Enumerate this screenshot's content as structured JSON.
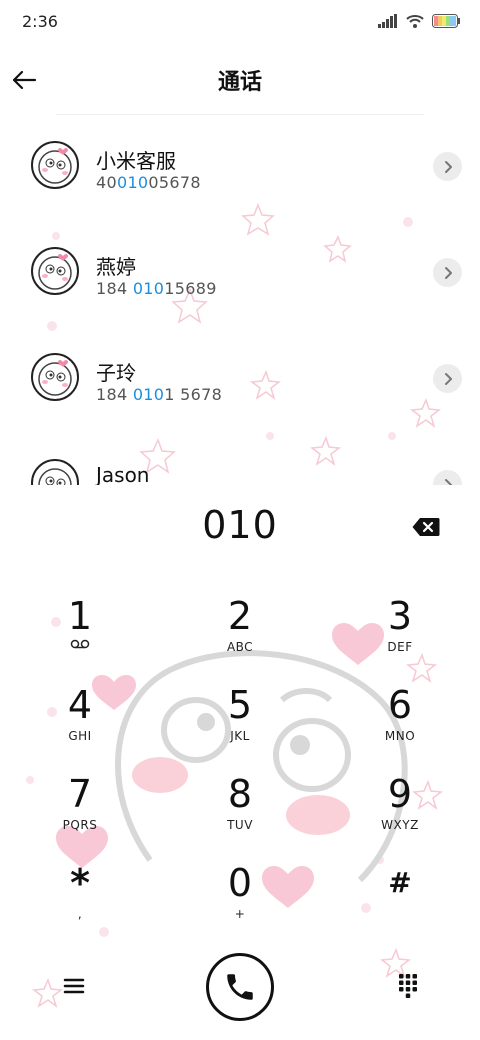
{
  "status_bar": {
    "time": "2:36"
  },
  "header": {
    "title": "通话"
  },
  "contacts": [
    {
      "name": "小米客服",
      "number_pre": "40",
      "number_match": "010",
      "number_post": "05678"
    },
    {
      "name": "燕婷",
      "number_pre": "184 ",
      "number_match": "010",
      "number_post": "15689"
    },
    {
      "name": "子玲",
      "number_pre": "184 ",
      "number_match": "010",
      "number_post": "1 5678"
    },
    {
      "name": "Jason",
      "number_pre": "",
      "number_match": "",
      "number_post": ""
    }
  ],
  "dialer": {
    "entered_number": "010"
  },
  "keypad": [
    {
      "digit": "1",
      "letters": ""
    },
    {
      "digit": "2",
      "letters": "ABC"
    },
    {
      "digit": "3",
      "letters": "DEF"
    },
    {
      "digit": "4",
      "letters": "GHI"
    },
    {
      "digit": "5",
      "letters": "JKL"
    },
    {
      "digit": "6",
      "letters": "MNO"
    },
    {
      "digit": "7",
      "letters": "PQRS"
    },
    {
      "digit": "8",
      "letters": "TUV"
    },
    {
      "digit": "9",
      "letters": "WXYZ"
    },
    {
      "digit": "*",
      "letters": ","
    },
    {
      "digit": "0",
      "letters": "+"
    },
    {
      "digit": "#",
      "letters": ""
    }
  ],
  "icons": {
    "back": "arrow-left-icon",
    "chevron": "chevron-right-icon",
    "backspace": "backspace-icon",
    "voicemail": "voicemail-icon",
    "menu": "hamburger-menu-icon",
    "call": "phone-icon",
    "dialpad": "dialpad-icon"
  },
  "colors": {
    "match_highlight": "#1a8fe0",
    "chevron_bg": "#ececec"
  }
}
